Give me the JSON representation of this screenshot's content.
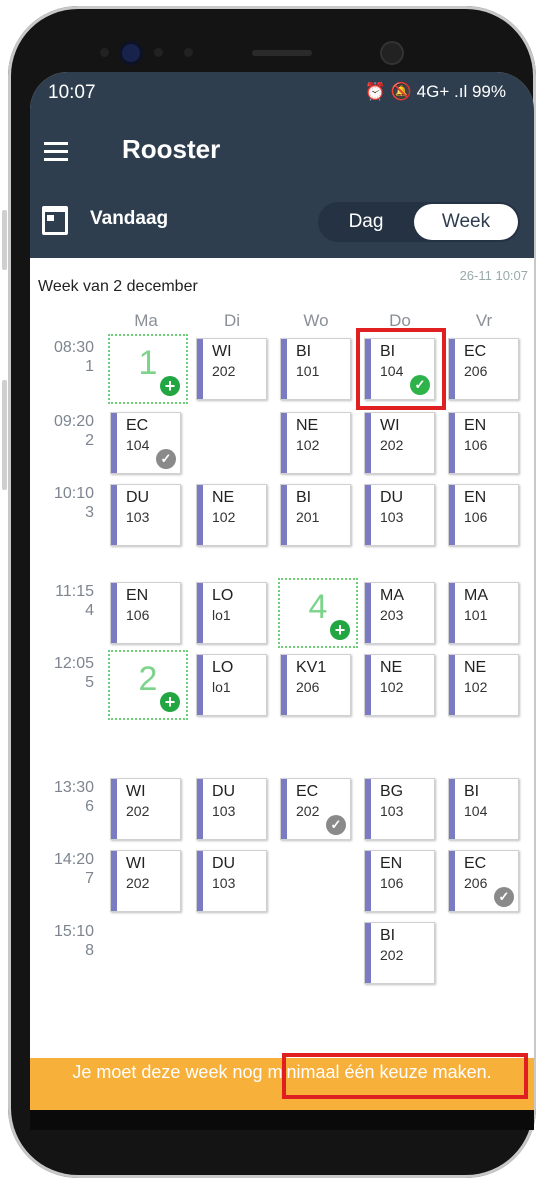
{
  "status": {
    "time": "10:07",
    "right": "⏰ 🔕 4G+ .ıl 99%"
  },
  "appbar": {
    "title": "Rooster"
  },
  "subbar": {
    "today": "Vandaag",
    "tab_day": "Dag",
    "tab_week": "Week"
  },
  "schedule": {
    "week_label": "Week van 2 december",
    "updated": "26-11 10:07",
    "days": [
      "Ma",
      "Di",
      "Wo",
      "Do",
      "Vr"
    ],
    "periods": [
      {
        "time": "08:30",
        "num": "1"
      },
      {
        "time": "09:20",
        "num": "2"
      },
      {
        "time": "10:10",
        "num": "3"
      },
      {
        "time": "11:15",
        "num": "4"
      },
      {
        "time": "12:05",
        "num": "5"
      },
      {
        "time": "13:30",
        "num": "6"
      },
      {
        "time": "14:20",
        "num": "7"
      },
      {
        "time": "15:10",
        "num": "8"
      }
    ],
    "lessons": [
      {
        "day": 1,
        "period": 0,
        "subject": "WI",
        "room": "202"
      },
      {
        "day": 2,
        "period": 0,
        "subject": "BI",
        "room": "101"
      },
      {
        "day": 3,
        "period": 0,
        "subject": "BI",
        "room": "104",
        "check": "green"
      },
      {
        "day": 4,
        "period": 0,
        "subject": "EC",
        "room": "206"
      },
      {
        "day": 0,
        "period": 1,
        "subject": "EC",
        "room": "104",
        "check": "gray"
      },
      {
        "day": 2,
        "period": 1,
        "subject": "NE",
        "room": "102"
      },
      {
        "day": 3,
        "period": 1,
        "subject": "WI",
        "room": "202"
      },
      {
        "day": 4,
        "period": 1,
        "subject": "EN",
        "room": "106"
      },
      {
        "day": 0,
        "period": 2,
        "subject": "DU",
        "room": "103"
      },
      {
        "day": 1,
        "period": 2,
        "subject": "NE",
        "room": "102"
      },
      {
        "day": 2,
        "period": 2,
        "subject": "BI",
        "room": "201"
      },
      {
        "day": 3,
        "period": 2,
        "subject": "DU",
        "room": "103"
      },
      {
        "day": 4,
        "period": 2,
        "subject": "EN",
        "room": "106"
      },
      {
        "day": 0,
        "period": 3,
        "subject": "EN",
        "room": "106"
      },
      {
        "day": 1,
        "period": 3,
        "subject": "LO",
        "room": "lo1"
      },
      {
        "day": 3,
        "period": 3,
        "subject": "MA",
        "room": "203"
      },
      {
        "day": 4,
        "period": 3,
        "subject": "MA",
        "room": "101"
      },
      {
        "day": 1,
        "period": 4,
        "subject": "LO",
        "room": "lo1"
      },
      {
        "day": 2,
        "period": 4,
        "subject": "KV1",
        "room": "206"
      },
      {
        "day": 3,
        "period": 4,
        "subject": "NE",
        "room": "102"
      },
      {
        "day": 4,
        "period": 4,
        "subject": "NE",
        "room": "102"
      },
      {
        "day": 0,
        "period": 5,
        "subject": "WI",
        "room": "202"
      },
      {
        "day": 1,
        "period": 5,
        "subject": "DU",
        "room": "103"
      },
      {
        "day": 2,
        "period": 5,
        "subject": "EC",
        "room": "202",
        "check": "gray"
      },
      {
        "day": 3,
        "period": 5,
        "subject": "BG",
        "room": "103"
      },
      {
        "day": 4,
        "period": 5,
        "subject": "BI",
        "room": "104"
      },
      {
        "day": 0,
        "period": 6,
        "subject": "WI",
        "room": "202"
      },
      {
        "day": 1,
        "period": 6,
        "subject": "DU",
        "room": "103"
      },
      {
        "day": 3,
        "period": 6,
        "subject": "EN",
        "room": "106"
      },
      {
        "day": 4,
        "period": 6,
        "subject": "EC",
        "room": "206",
        "check": "gray"
      },
      {
        "day": 3,
        "period": 7,
        "subject": "BI",
        "room": "202"
      }
    ],
    "choices": [
      {
        "day": 0,
        "period": 0,
        "label": "1"
      },
      {
        "day": 2,
        "period": 3,
        "label": "4"
      },
      {
        "day": 0,
        "period": 4,
        "label": "2"
      }
    ]
  },
  "banner": {
    "text": "Je moet deze week nog minimaal één keuze maken."
  },
  "colors": {
    "header": "#2f3e4f",
    "lesson_bar": "#7b7bc4",
    "banner": "#f7b03a",
    "highlight": "#e02020"
  }
}
